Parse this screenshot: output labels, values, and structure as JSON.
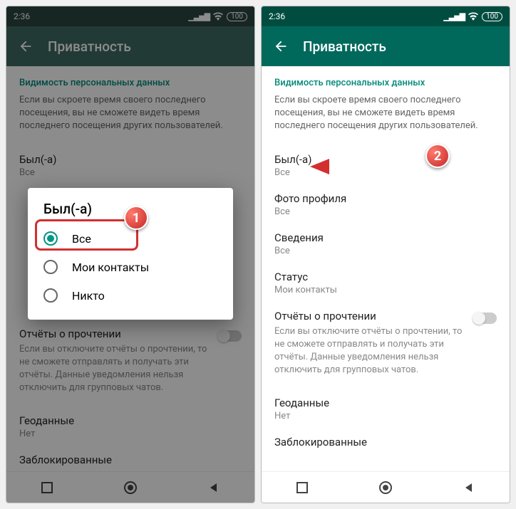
{
  "status": {
    "time": "2:36",
    "battery": "100"
  },
  "appbar": {
    "title": "Приватность"
  },
  "section": {
    "header": "Видимость персональных данных",
    "sub": "Если вы скроете время своего последнего посещения, вы не сможете видеть время последнего посещения других пользователей."
  },
  "items": {
    "lastseen": {
      "label": "Был(-а)",
      "value": "Все"
    },
    "photo": {
      "label": "Фото профиля",
      "value": "Все"
    },
    "about": {
      "label": "Сведения",
      "value": "Все"
    },
    "status": {
      "label": "Статус",
      "value": "Мои контакты"
    },
    "readreceipts": {
      "label": "Отчёты о прочтении",
      "desc": "Если вы отключите отчёты о прочтении, то не сможете отправлять и получать эти отчёты. Данные уведомления нельзя отключить для групповых чатов."
    },
    "geo": {
      "label": "Геоданные",
      "value": "Нет"
    },
    "blocked": {
      "label": "Заблокированные"
    }
  },
  "dialog": {
    "title": "Был(-а)",
    "options": [
      "Все",
      "Мои контакты",
      "Никто"
    ]
  },
  "badges": {
    "one": "1",
    "two": "2"
  }
}
